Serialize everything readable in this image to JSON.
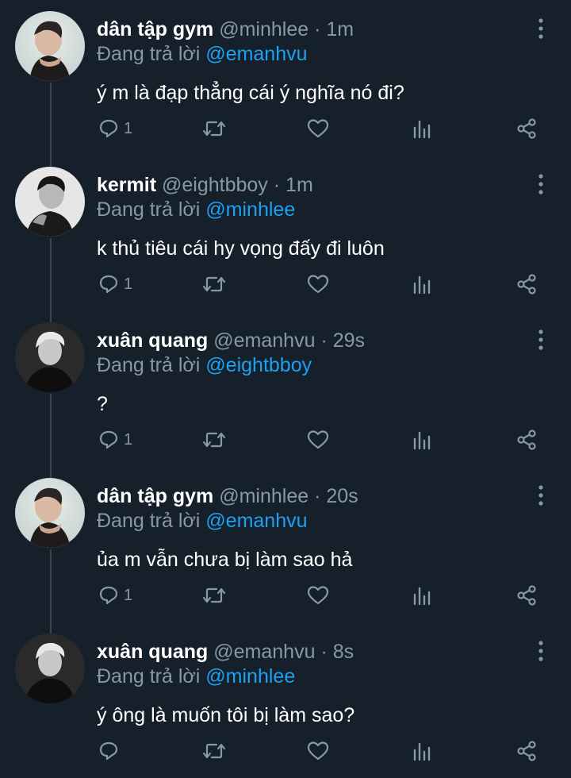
{
  "tweets": [
    {
      "name": "dân tập gym",
      "handle": "@minhlee",
      "time": "1m",
      "reply_prefix": "Đang trả lời",
      "reply_to": "@emanhvu",
      "text": "ý m là đạp thẳng cái ý nghĩa nó đi?",
      "reply_count": "1",
      "avatar": "avatar-dan-tap-gym"
    },
    {
      "name": "kermit",
      "handle": "@eightbboy",
      "time": "1m",
      "reply_prefix": "Đang trả lời",
      "reply_to": "@minhlee",
      "text": "k thủ tiêu cái hy vọng đấy đi luôn",
      "reply_count": "1",
      "avatar": "avatar-kermit"
    },
    {
      "name": "xuân quang",
      "handle": "@emanhvu",
      "time": "29s",
      "reply_prefix": "Đang trả lời",
      "reply_to": "@eightbboy",
      "text": "?",
      "reply_count": "1",
      "avatar": "avatar-xuan-quang"
    },
    {
      "name": "dân tập gym",
      "handle": "@minhlee",
      "time": "20s",
      "reply_prefix": "Đang trả lời",
      "reply_to": "@emanhvu",
      "text": "ủa m vẫn chưa bị làm sao hả",
      "reply_count": "1",
      "avatar": "avatar-dan-tap-gym"
    },
    {
      "name": "xuân quang",
      "handle": "@emanhvu",
      "time": "8s",
      "reply_prefix": "Đang trả lời",
      "reply_to": "@minhlee",
      "text": "ý ông là muốn tôi bị làm sao?",
      "reply_count": "",
      "avatar": "avatar-xuan-quang"
    }
  ],
  "separator": "·",
  "colors": {
    "background": "#15202b",
    "muted": "#8899a6",
    "accent": "#1da1f2",
    "thread_line": "#38444d"
  },
  "icons": [
    "reply-icon",
    "retweet-icon",
    "like-icon",
    "analytics-icon",
    "share-icon",
    "more-options-icon"
  ]
}
